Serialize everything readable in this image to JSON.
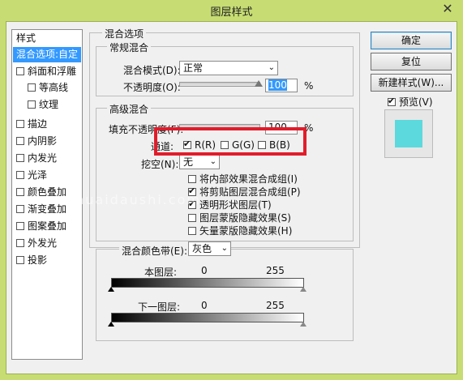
{
  "window": {
    "title": "图层样式",
    "close_glyph": "✕"
  },
  "sidebar": {
    "items": [
      {
        "label": "样式",
        "checkbox": false,
        "checked": false,
        "selected": false,
        "indent": false
      },
      {
        "label": "混合选项:自定",
        "checkbox": false,
        "checked": false,
        "selected": true,
        "indent": false
      },
      {
        "label": "斜面和浮雕",
        "checkbox": true,
        "checked": false,
        "selected": false,
        "indent": false
      },
      {
        "label": "等高线",
        "checkbox": true,
        "checked": false,
        "selected": false,
        "indent": true
      },
      {
        "label": "纹理",
        "checkbox": true,
        "checked": false,
        "selected": false,
        "indent": true
      },
      {
        "label": "描边",
        "checkbox": true,
        "checked": false,
        "selected": false,
        "indent": false
      },
      {
        "label": "内阴影",
        "checkbox": true,
        "checked": false,
        "selected": false,
        "indent": false
      },
      {
        "label": "内发光",
        "checkbox": true,
        "checked": false,
        "selected": false,
        "indent": false
      },
      {
        "label": "光泽",
        "checkbox": true,
        "checked": false,
        "selected": false,
        "indent": false
      },
      {
        "label": "颜色叠加",
        "checkbox": true,
        "checked": false,
        "selected": false,
        "indent": false
      },
      {
        "label": "渐变叠加",
        "checkbox": true,
        "checked": false,
        "selected": false,
        "indent": false
      },
      {
        "label": "图案叠加",
        "checkbox": true,
        "checked": false,
        "selected": false,
        "indent": false
      },
      {
        "label": "外发光",
        "checkbox": true,
        "checked": false,
        "selected": false,
        "indent": false
      },
      {
        "label": "投影",
        "checkbox": true,
        "checked": false,
        "selected": false,
        "indent": false
      }
    ]
  },
  "blending": {
    "section_title": "混合选项",
    "general": {
      "title": "常规混合",
      "mode_label": "混合模式(D):",
      "mode_value": "正常",
      "opacity_label": "不透明度(O):",
      "opacity_value": "100",
      "opacity_unit": "%"
    },
    "advanced": {
      "title": "高级混合",
      "fill_label": "填充不透明度(F):",
      "fill_value": "100",
      "fill_unit": "%",
      "channels_label": "通道:",
      "channel_r": "R(R)",
      "channel_g": "G(G)",
      "channel_b": "B(B)",
      "channel_r_checked": true,
      "channel_g_checked": false,
      "channel_b_checked": false,
      "knockout_label": "挖空(N):",
      "knockout_value": "无",
      "options": [
        {
          "label": "将内部效果混合成组(I)",
          "checked": false
        },
        {
          "label": "将剪贴图层混合成组(P)",
          "checked": true
        },
        {
          "label": "透明形状图层(T)",
          "checked": true
        },
        {
          "label": "图层蒙版隐藏效果(S)",
          "checked": false
        },
        {
          "label": "矢量蒙版隐藏效果(H)",
          "checked": false
        }
      ]
    },
    "blend_if": {
      "label": "混合颜色带(E):",
      "value": "灰色",
      "this_layer_label": "本图层:",
      "this_layer_min": "0",
      "this_layer_max": "255",
      "underlying_label": "下一图层:",
      "underlying_min": "0",
      "underlying_max": "255"
    }
  },
  "buttons": {
    "ok": "确定",
    "reset": "复位",
    "new_style": "新建样式(W)...",
    "preview_label": "预览(V)",
    "preview_checked": true
  },
  "preview_swatch_color": "#5bd9dd",
  "highlight_color": "#e11c2b",
  "watermark_text": "www.yishuaidaushi.com"
}
